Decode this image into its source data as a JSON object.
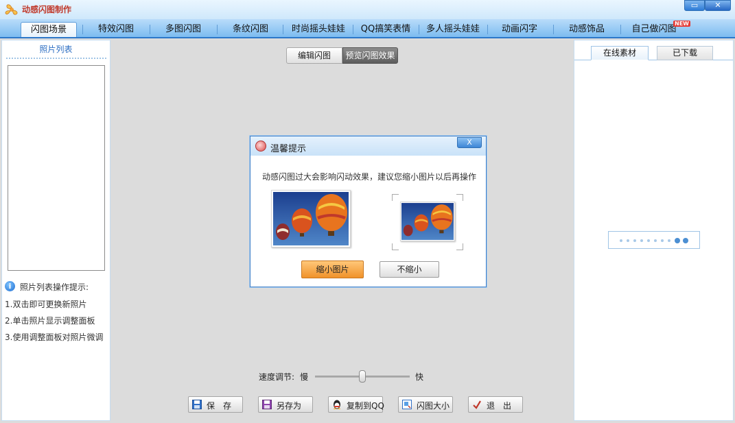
{
  "window": {
    "title": "动感闪图制作",
    "maximize_glyph": "▭",
    "close_glyph": "✕"
  },
  "nav": {
    "tabs": [
      {
        "label": "闪图场景",
        "active": true
      },
      {
        "label": "特效闪图"
      },
      {
        "label": "多图闪图"
      },
      {
        "label": "条纹闪图"
      },
      {
        "label": "时尚摇头娃娃"
      },
      {
        "label": "QQ搞笑表情"
      },
      {
        "label": "多人摇头娃娃"
      },
      {
        "label": "动画闪字"
      },
      {
        "label": "动感饰品"
      },
      {
        "label": "自己做闪图"
      }
    ],
    "new_badge": "NEW"
  },
  "left_panel": {
    "title": "照片列表",
    "tips_icon": "info-icon",
    "tips_title": "照片列表操作提示:",
    "tips": [
      "1.双击即可更换新照片",
      "2.单击照片显示调整面板",
      "3.使用调整面板对照片微调"
    ]
  },
  "center": {
    "mode_tabs": {
      "edit": "编辑闪图",
      "preview": "预览闪图效果",
      "active": "preview"
    },
    "speed": {
      "label": "速度调节:",
      "slow": "慢",
      "fast": "快",
      "value": 0.5
    },
    "toolbar": [
      {
        "label": "保　存",
        "icon": "floppy-icon"
      },
      {
        "label": "另存为",
        "icon": "save-as-icon"
      },
      {
        "label": "复制到QQ",
        "icon": "qq-penguin-icon"
      },
      {
        "label": "闪图大小",
        "icon": "resize-icon"
      },
      {
        "label": "退　出",
        "icon": "exit-icon"
      }
    ]
  },
  "dialog": {
    "title": "温馨提示",
    "close_glyph": "X",
    "message": "动感闪图过大会影响闪动效果，建议您缩小图片以后再操作",
    "shrink_button": "缩小图片",
    "no_shrink_button": "不缩小"
  },
  "right_panel": {
    "tabs": [
      {
        "label": "在线素材",
        "active": true
      },
      {
        "label": "已下载"
      }
    ],
    "loading_progress": 0.8
  },
  "colors": {
    "accent": "#2b77c9",
    "nav_bg": "#7cbcf0",
    "shrink_button": "#f0922a",
    "title_text": "#c0392b"
  }
}
